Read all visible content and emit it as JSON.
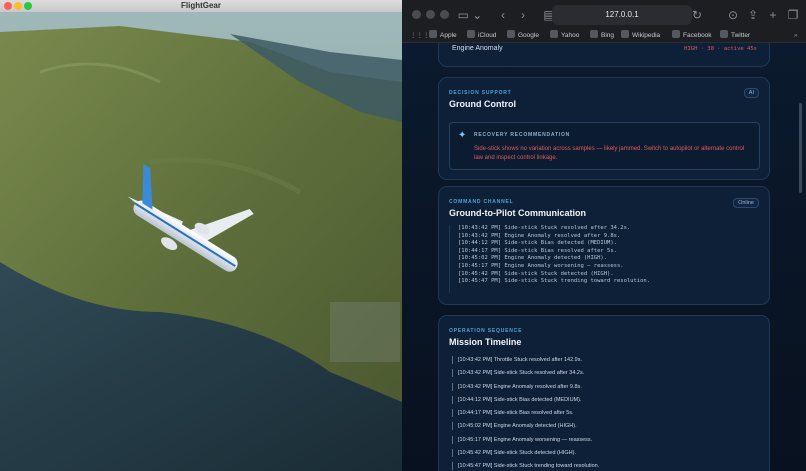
{
  "flightgear": {
    "title": "FlightGear",
    "traffic_lights": [
      "#fe5f57",
      "#febc2e",
      "#28c840"
    ]
  },
  "browser": {
    "url": "127.0.0.1",
    "bookmarks": [
      "Apple",
      "iCloud",
      "Google",
      "Yahoo",
      "Bing",
      "Wikipedia",
      "Facebook",
      "Twitter"
    ]
  },
  "anomaly_row": {
    "label": "Engine Anomaly",
    "status": "HIGH · 30 · active 45s"
  },
  "decision_support": {
    "eyebrow": "DECISION SUPPORT",
    "title": "Ground Control",
    "badge": "AI",
    "rec_label": "RECOVERY RECOMMENDATION",
    "rec_text": "Side-stick shows no variation across samples — likely jammed. Switch to autopilot or alternate control law and inspect control linkage."
  },
  "command_channel": {
    "eyebrow": "COMMAND CHANNEL",
    "title": "Ground-to-Pilot Communication",
    "status": "Online",
    "log": [
      "[10:43:42 PM] Side-stick Stuck resolved after 34.2s.",
      "[10:43:42 PM] Engine Anomaly resolved after 9.8s.",
      "[10:44:12 PM] Side-stick Bias detected (MEDIUM).",
      "[10:44:17 PM] Side-stick Bias resolved after 5s.",
      "[10:45:02 PM] Engine Anomaly detected (HIGH).",
      "[10:45:17 PM] Engine Anomaly worsening — reassess.",
      "[10:45:42 PM] Side-stick Stuck detected (HIGH).",
      "[10:45:47 PM] Side-stick Stuck trending toward resolution."
    ]
  },
  "operation_sequence": {
    "eyebrow": "OPERATION SEQUENCE",
    "title": "Mission Timeline",
    "items": [
      "[10:43:42 PM] Throttle Stuck resolved after 142.9s.",
      "[10:43:42 PM] Side-stick Stuck resolved after 34.2s.",
      "[10:43:42 PM] Engine Anomaly resolved after 9.8s.",
      "[10:44:12 PM] Side-stick Bias detected (MEDIUM).",
      "[10:44:17 PM] Side-stick Bias resolved after 5s.",
      "[10:45:02 PM] Engine Anomaly detected (HIGH).",
      "[10:45:17 PM] Engine Anomaly worsening — reassess.",
      "[10:45:42 PM] Side-stick Stuck detected (HIGH).",
      "[10:45:47 PM] Side-stick Stuck trending toward resolution."
    ]
  }
}
